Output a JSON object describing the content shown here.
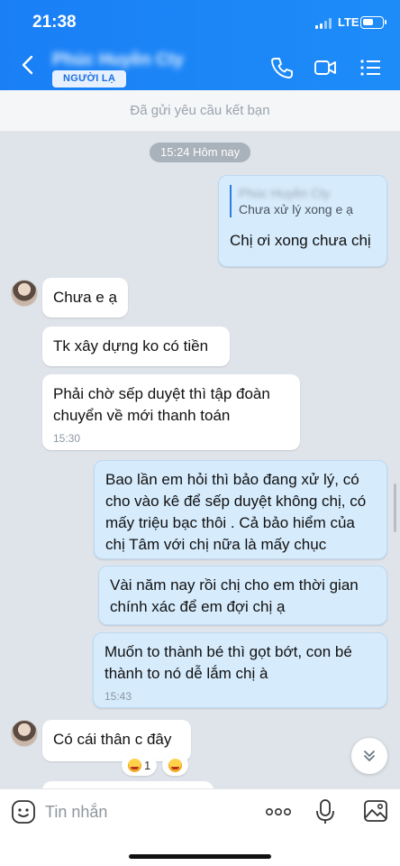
{
  "status_bar": {
    "time": "21:38",
    "network": "LTE",
    "battery_level": 0.6
  },
  "header": {
    "contact_name": "Phúc Huyền Cty",
    "tag": "NGƯỜI LẠ"
  },
  "banner": {
    "text": "Đã gửi yêu cầu kết bạn"
  },
  "chat": {
    "time_divider": "15:24 Hôm nay",
    "messages": [
      {
        "dir": "out",
        "quote_name": "Phúc Huyền Cty",
        "quote_text": "Chưa xử lý xong e ạ",
        "text": "Chị ơi xong chưa chị"
      },
      {
        "dir": "in",
        "text": "Chưa e ạ"
      },
      {
        "dir": "in",
        "text": "Tk xây dựng ko có tiền"
      },
      {
        "dir": "in",
        "text": "Phải chờ sếp duyệt thì tập đoàn chuyển về mới thanh toán",
        "time": "15:30"
      },
      {
        "dir": "out",
        "text": "Bao lần em hỏi thì bảo đang xử lý, có cho vào kê để sếp duyệt không chị, có mấy triệu bạc thôi . Cả bảo hiểm của chị Tâm với chị nữa là mấy chục"
      },
      {
        "dir": "out",
        "text": "Vài năm nay rồi chị cho em thời gian chính xác để em đợi chị ạ"
      },
      {
        "dir": "out",
        "text": "Muốn to thành bé thì gọt bớt, con bé thành to nó dễ lắm chị à",
        "time": "15:43"
      },
      {
        "dir": "in",
        "text": "Có cái thân c đây"
      }
    ],
    "reaction": {
      "emoji": "laugh",
      "count": "1"
    }
  },
  "input": {
    "placeholder": "Tin nhắn"
  },
  "icons": [
    "back-icon",
    "phone-icon",
    "video-call-icon",
    "menu-icon",
    "emoji-icon",
    "more-icon",
    "mic-icon",
    "image-icon",
    "chevron-down-icon"
  ],
  "colors": {
    "header": "#1a7ff5",
    "outgoing_bubble": "#d6ebfc",
    "incoming_bubble": "#ffffff",
    "background": "#dfe4ea"
  }
}
